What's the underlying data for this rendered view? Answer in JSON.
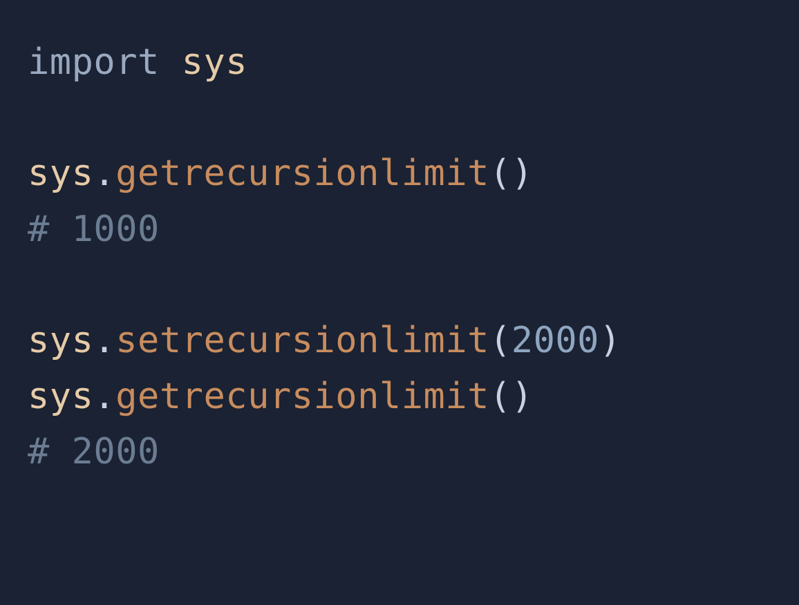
{
  "code": {
    "lines": [
      {
        "tokens": [
          {
            "cls": "tok-keyword",
            "text": "import"
          },
          {
            "cls": "tok-keyword",
            "text": " "
          },
          {
            "cls": "tok-ident",
            "text": "sys"
          }
        ]
      },
      {
        "tokens": []
      },
      {
        "tokens": [
          {
            "cls": "tok-ident",
            "text": "sys"
          },
          {
            "cls": "tok-dot",
            "text": "."
          },
          {
            "cls": "tok-func",
            "text": "getrecursionlimit"
          },
          {
            "cls": "tok-paren",
            "text": "()"
          }
        ]
      },
      {
        "tokens": [
          {
            "cls": "tok-comment",
            "text": "# 1000"
          }
        ]
      },
      {
        "tokens": []
      },
      {
        "tokens": [
          {
            "cls": "tok-ident",
            "text": "sys"
          },
          {
            "cls": "tok-dot",
            "text": "."
          },
          {
            "cls": "tok-func",
            "text": "setrecursionlimit"
          },
          {
            "cls": "tok-paren",
            "text": "("
          },
          {
            "cls": "tok-num",
            "text": "2000"
          },
          {
            "cls": "tok-paren",
            "text": ")"
          }
        ]
      },
      {
        "tokens": [
          {
            "cls": "tok-ident",
            "text": "sys"
          },
          {
            "cls": "tok-dot",
            "text": "."
          },
          {
            "cls": "tok-func",
            "text": "getrecursionlimit"
          },
          {
            "cls": "tok-paren",
            "text": "()"
          }
        ]
      },
      {
        "tokens": [
          {
            "cls": "tok-comment",
            "text": "# 2000"
          }
        ]
      }
    ]
  }
}
